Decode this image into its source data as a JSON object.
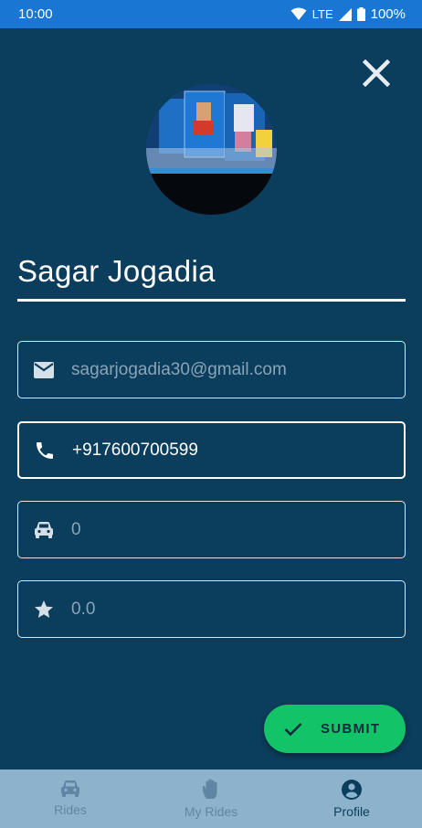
{
  "status_bar": {
    "time": "10:00",
    "network": "LTE",
    "battery": "100%"
  },
  "profile": {
    "name": "Sagar Jogadia",
    "email": "sagarjogadia30@gmail.com",
    "phone": "+917600700599",
    "rides": "0",
    "rating": "0.0"
  },
  "submit": {
    "label": "SUBMIT"
  },
  "nav": {
    "items": [
      {
        "label": "Rides",
        "icon": "car-icon"
      },
      {
        "label": "My Rides",
        "icon": "hand-icon"
      },
      {
        "label": "Profile",
        "icon": "account-icon"
      }
    ],
    "active_index": 2
  },
  "colors": {
    "background": "#0b3d5c",
    "status_bar": "#1976d2",
    "submit_button": "#12c467",
    "bottom_nav": "#8db3cc"
  }
}
